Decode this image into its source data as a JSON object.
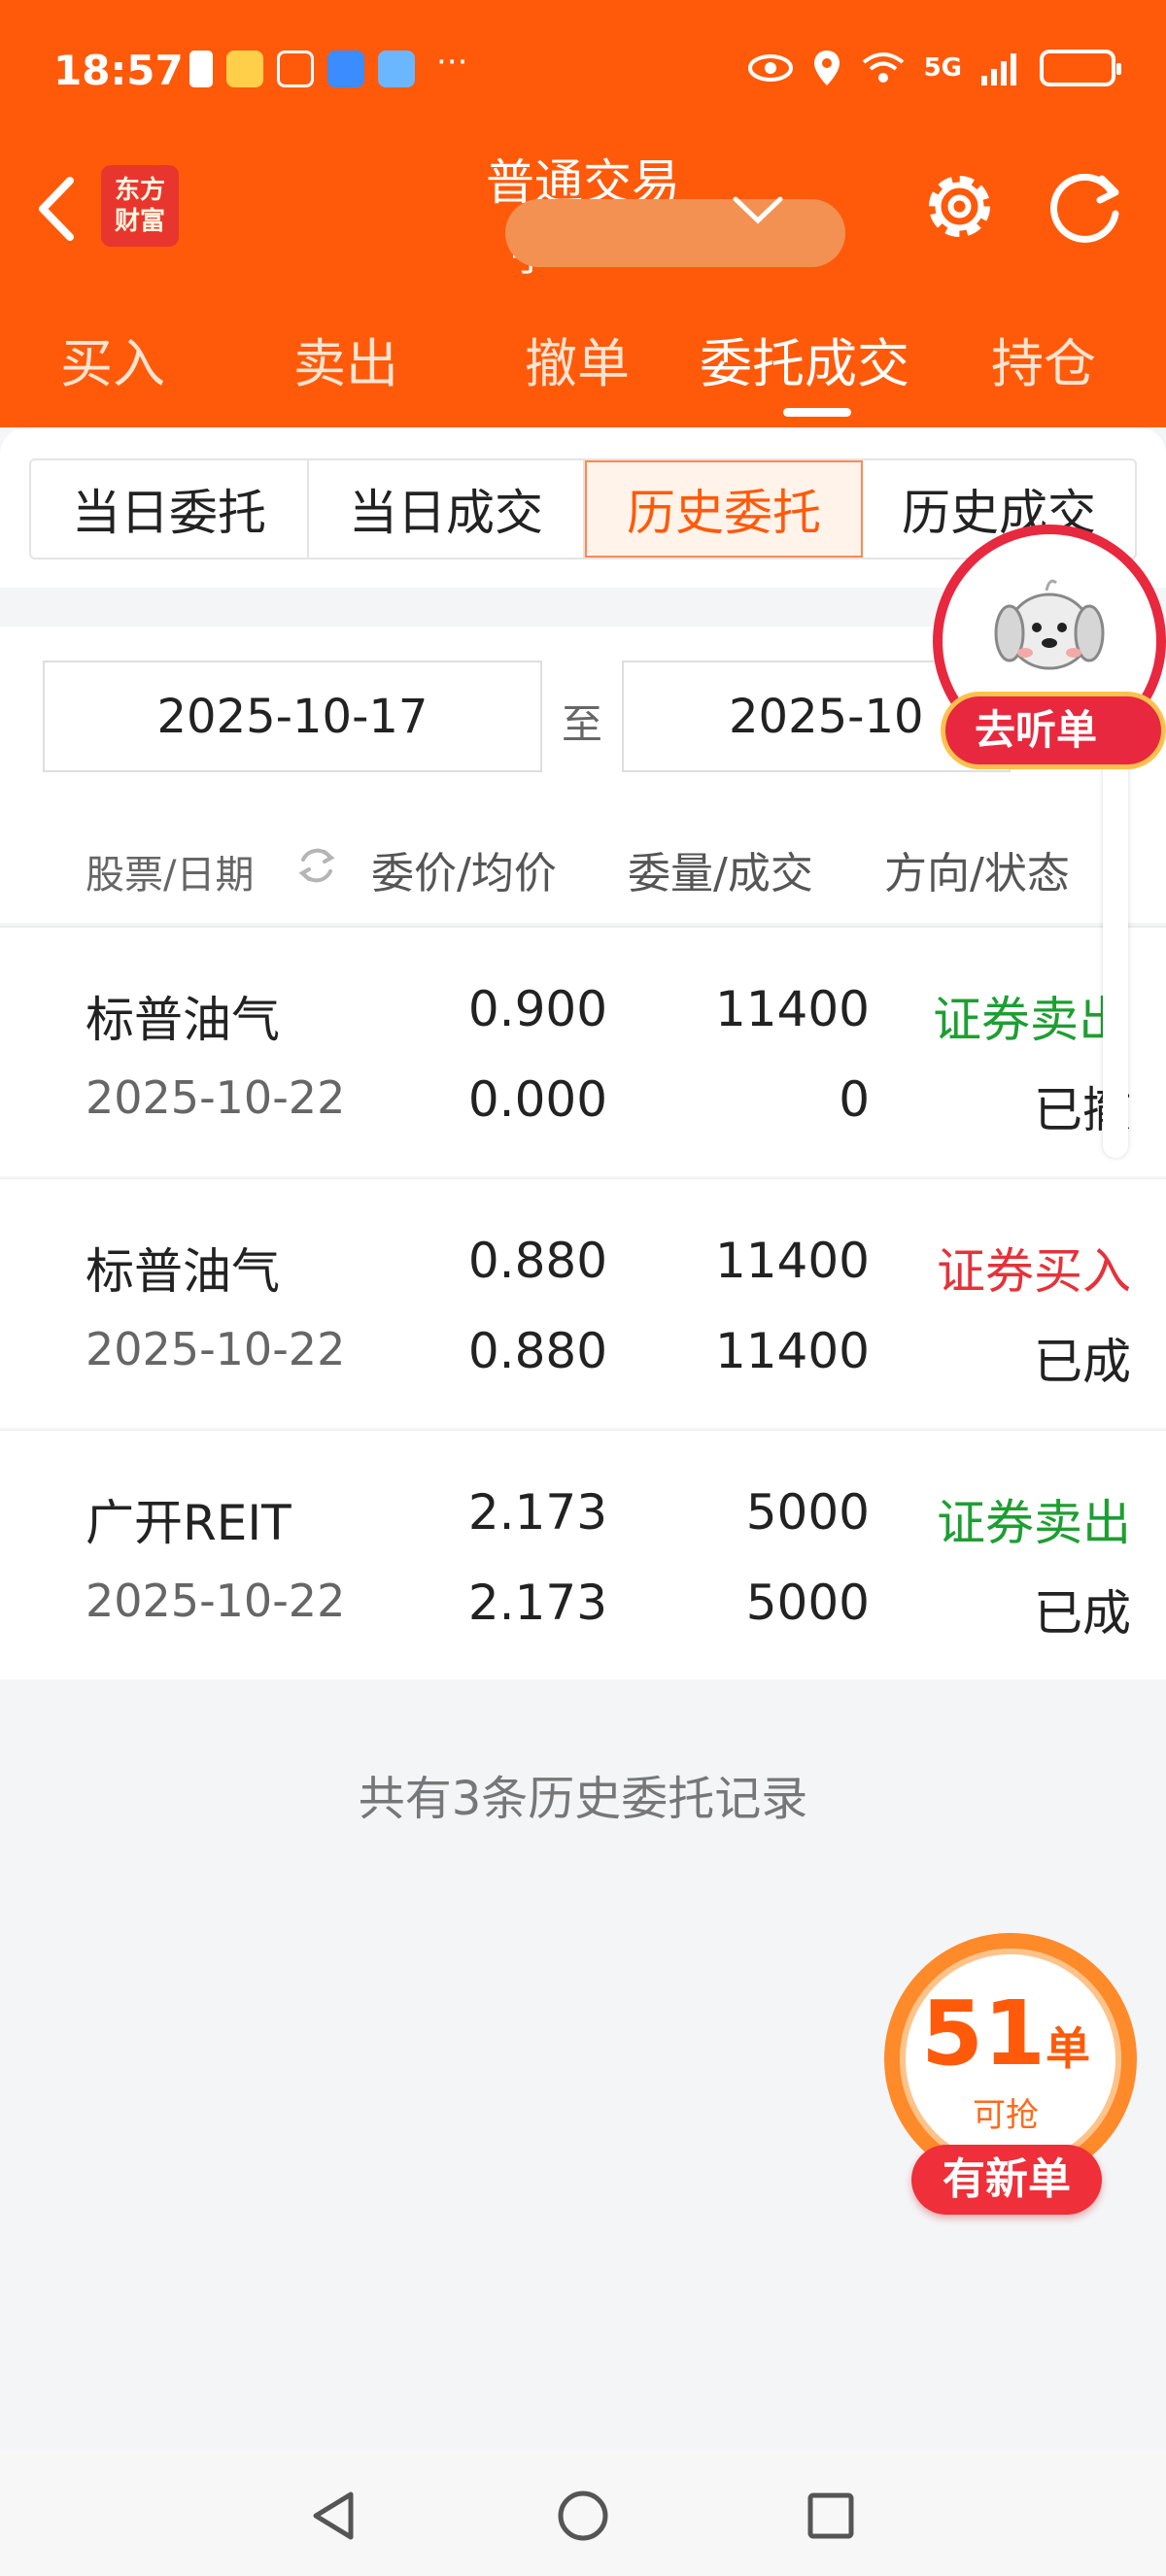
{
  "status_bar": {
    "time": "18:57",
    "network": "5G",
    "more": "···"
  },
  "header": {
    "title": "普通交易",
    "logo_text": [
      "东方",
      "财富"
    ],
    "account_partial": "子"
  },
  "main_tabs": [
    {
      "label": "买入",
      "active": false
    },
    {
      "label": "卖出",
      "active": false
    },
    {
      "label": "撤单",
      "active": false
    },
    {
      "label": "委托成交",
      "active": true
    },
    {
      "label": "持仓",
      "active": false
    }
  ],
  "sub_tabs": [
    {
      "label": "当日委托",
      "active": false
    },
    {
      "label": "当日成交",
      "active": false
    },
    {
      "label": "历史委托",
      "active": true
    },
    {
      "label": "历史成交",
      "active": false
    }
  ],
  "date_range": {
    "start": "2025-10-17",
    "separator": "至",
    "end": "2025-10"
  },
  "columns": {
    "stock_date": "股票/日期",
    "price": "委价/均价",
    "qty": "委量/成交",
    "status": "方向/状态"
  },
  "orders": [
    {
      "name": "标普油气",
      "date": "2025-10-22",
      "price": "0.900",
      "avg": "0.000",
      "qty": "11400",
      "filled": "0",
      "direction": "证券卖出",
      "direction_type": "sell",
      "status": "已撤"
    },
    {
      "name": "标普油气",
      "date": "2025-10-22",
      "price": "0.880",
      "avg": "0.880",
      "qty": "11400",
      "filled": "11400",
      "direction": "证券买入",
      "direction_type": "buy",
      "status": "已成"
    },
    {
      "name": "广开REIT",
      "date": "2025-10-22",
      "price": "2.173",
      "avg": "2.173",
      "qty": "5000",
      "filled": "5000",
      "direction": "证券卖出",
      "direction_type": "sell",
      "status": "已成"
    }
  ],
  "summary": "共有3条历史委托记录",
  "float_ad": {
    "label": "去听单"
  },
  "promo": {
    "count": "51",
    "unit": "单",
    "sub": "可抢",
    "button": "有新单"
  },
  "colors": {
    "brand": "#ff5a0a",
    "sell": "#1e9e32",
    "buy": "#e5323a"
  }
}
